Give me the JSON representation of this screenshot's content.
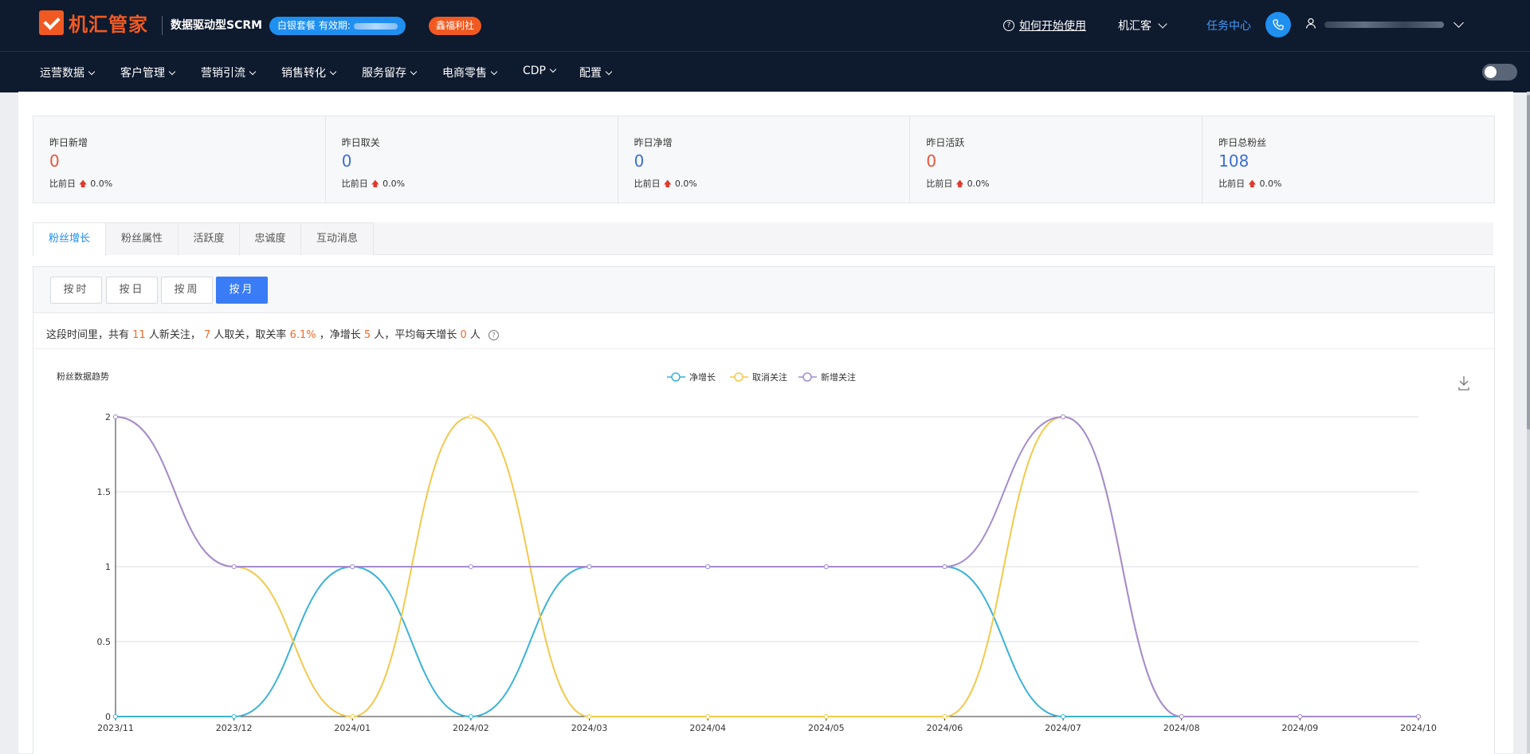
{
  "header": {
    "logo_text": "机汇管家",
    "subtitle": "数据驱动型SCRM",
    "package_label": "白银套餐 有效期:",
    "welfare_label": "鑫福利社",
    "help_label": "如何开始使用",
    "app_switch_label": "机汇客",
    "task_center_label": "任务中心",
    "icons": {
      "help": "question-circle-icon",
      "phone": "phone-icon",
      "user": "user-icon"
    }
  },
  "nav": {
    "items": [
      {
        "label": "运营数据"
      },
      {
        "label": "客户管理"
      },
      {
        "label": "营销引流"
      },
      {
        "label": "销售转化"
      },
      {
        "label": "服务留存"
      },
      {
        "label": "电商零售"
      },
      {
        "label": "CDP"
      },
      {
        "label": "配置"
      }
    ]
  },
  "stats": [
    {
      "label": "昨日新增",
      "value": "0",
      "compare_label": "比前日",
      "change": "0.0%",
      "color": "#e8553a"
    },
    {
      "label": "昨日取关",
      "value": "0",
      "compare_label": "比前日",
      "change": "0.0%",
      "color": "#3b6fd4"
    },
    {
      "label": "昨日净增",
      "value": "0",
      "compare_label": "比前日",
      "change": "0.0%",
      "color": "#3b6fd4"
    },
    {
      "label": "昨日活跃",
      "value": "0",
      "compare_label": "比前日",
      "change": "0.0%",
      "color": "#e8553a"
    },
    {
      "label": "昨日总粉丝",
      "value": "108",
      "compare_label": "比前日",
      "change": "0.0%",
      "color": "#3b6fd4"
    }
  ],
  "tabs": [
    {
      "label": "粉丝增长",
      "active": true
    },
    {
      "label": "粉丝属性",
      "active": false
    },
    {
      "label": "活跃度",
      "active": false
    },
    {
      "label": "忠诚度",
      "active": false
    },
    {
      "label": "互动消息",
      "active": false
    }
  ],
  "granularity": [
    {
      "label": "按时",
      "active": false
    },
    {
      "label": "按日",
      "active": false
    },
    {
      "label": "按周",
      "active": false
    },
    {
      "label": "按月",
      "active": true
    }
  ],
  "summary": {
    "p1": "这段时间里，共有",
    "new": "11",
    "p2": "人新关注，",
    "unfollow": "7",
    "p3": "人取关，取关率",
    "rate": "6.1%",
    "p4": "，净增长",
    "net": "5",
    "p5": "人，平均每天增长",
    "avg": "0",
    "p6": "人"
  },
  "chart_data": {
    "type": "line",
    "title": "粉丝数据趋势",
    "categories": [
      "2023/11",
      "2023/12",
      "2024/01",
      "2024/02",
      "2024/03",
      "2024/04",
      "2024/05",
      "2024/06",
      "2024/07",
      "2024/08",
      "2024/09",
      "2024/10"
    ],
    "ylim": [
      0,
      2
    ],
    "yticks": [
      "0",
      "0.5",
      "1",
      "1.5",
      "2"
    ],
    "grid": true,
    "legend_position": "top-center",
    "smooth": true,
    "series": [
      {
        "name": "净增长",
        "color": "#3bb2d6",
        "values": [
          0,
          0,
          1,
          0,
          1,
          1,
          1,
          1,
          0,
          0,
          0,
          0
        ]
      },
      {
        "name": "取消关注",
        "color": "#f2c94c",
        "values": [
          2,
          1,
          0,
          2,
          0,
          0,
          0,
          0,
          2,
          0,
          0,
          0
        ]
      },
      {
        "name": "新增关注",
        "color": "#a48bd2",
        "values": [
          2,
          1,
          1,
          1,
          1,
          1,
          1,
          1,
          2,
          0,
          0,
          0
        ]
      }
    ]
  }
}
